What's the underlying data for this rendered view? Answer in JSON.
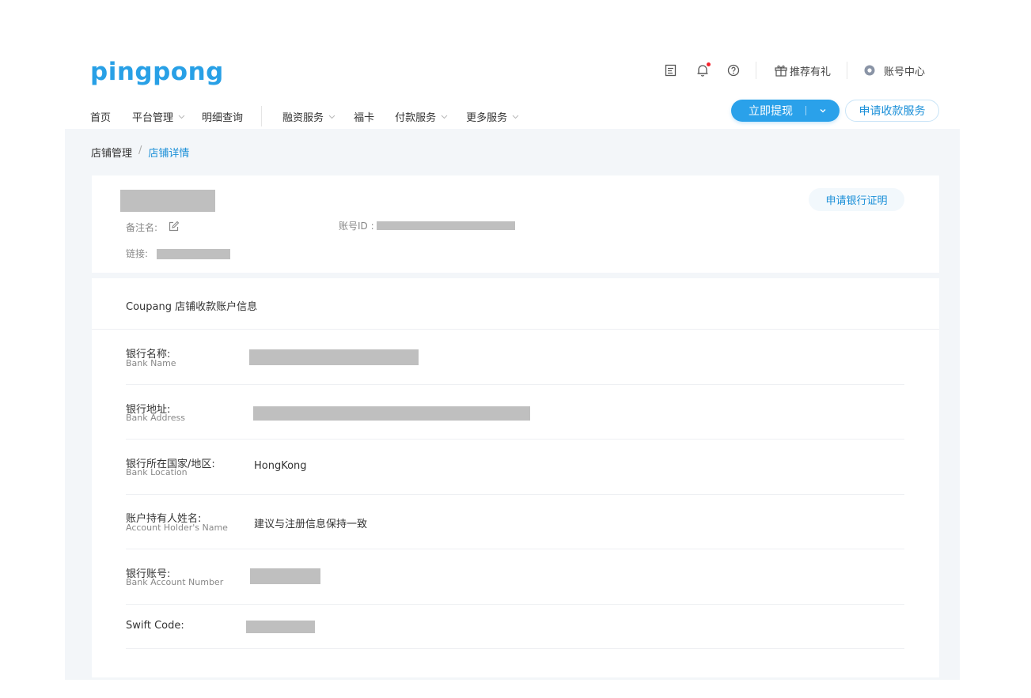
{
  "brand": {
    "logo": "pingpong",
    "accent": "#28a0e6"
  },
  "top_bar": {
    "icons": [
      "edit-note-icon",
      "bell-icon",
      "help-icon"
    ],
    "notification_dot": "#f5222d",
    "referral_label": "推荐有礼",
    "account_center_label": "账号中心"
  },
  "nav": {
    "items": [
      {
        "label": "首页",
        "dropdown": false
      },
      {
        "label": "平台管理",
        "dropdown": true
      },
      {
        "label": "明细查询",
        "dropdown": false
      },
      {
        "label": "融资服务",
        "dropdown": true
      },
      {
        "label": "福卡",
        "dropdown": false
      },
      {
        "label": "付款服务",
        "dropdown": true
      },
      {
        "label": "更多服务",
        "dropdown": true
      }
    ],
    "withdraw_button": "立即提现",
    "apply_button": "申请收款服务"
  },
  "breadcrumb": {
    "parent": "店铺管理",
    "separator": "/",
    "current": "店铺详情"
  },
  "store_card": {
    "remark_label": "备注名:",
    "account_id_label": "账号ID :",
    "link_label": "链接:",
    "bank_cert_button": "申请银行证明"
  },
  "account_card": {
    "title": "Coupang 店铺收款账户信息",
    "rows": [
      {
        "label_zh": "银行名称:",
        "label_en": "Bank Name",
        "value": ""
      },
      {
        "label_zh": "银行地址:",
        "label_en": "Bank Address",
        "value": ""
      },
      {
        "label_zh": "银行所在国家/地区:",
        "label_en": "Bank Location",
        "value": "HongKong"
      },
      {
        "label_zh": "账户持有人姓名:",
        "label_en": "Account Holder's Name",
        "value": "建议与注册信息保持一致"
      },
      {
        "label_zh": "银行账号:",
        "label_en": "Bank Account Number",
        "value": ""
      },
      {
        "label_zh": "Swift Code:",
        "label_en": "",
        "value": ""
      }
    ]
  }
}
